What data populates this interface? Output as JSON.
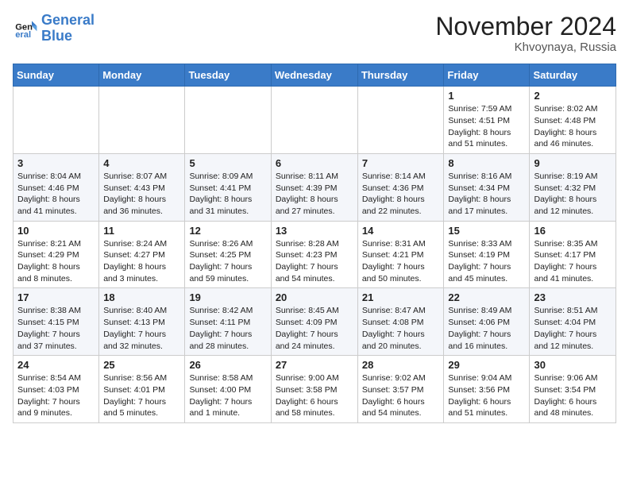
{
  "header": {
    "logo_line1": "General",
    "logo_line2": "Blue",
    "month_year": "November 2024",
    "location": "Khvoynaya, Russia"
  },
  "days_of_week": [
    "Sunday",
    "Monday",
    "Tuesday",
    "Wednesday",
    "Thursday",
    "Friday",
    "Saturday"
  ],
  "weeks": [
    [
      {
        "day": "",
        "info": ""
      },
      {
        "day": "",
        "info": ""
      },
      {
        "day": "",
        "info": ""
      },
      {
        "day": "",
        "info": ""
      },
      {
        "day": "",
        "info": ""
      },
      {
        "day": "1",
        "info": "Sunrise: 7:59 AM\nSunset: 4:51 PM\nDaylight: 8 hours and 51 minutes."
      },
      {
        "day": "2",
        "info": "Sunrise: 8:02 AM\nSunset: 4:48 PM\nDaylight: 8 hours and 46 minutes."
      }
    ],
    [
      {
        "day": "3",
        "info": "Sunrise: 8:04 AM\nSunset: 4:46 PM\nDaylight: 8 hours and 41 minutes."
      },
      {
        "day": "4",
        "info": "Sunrise: 8:07 AM\nSunset: 4:43 PM\nDaylight: 8 hours and 36 minutes."
      },
      {
        "day": "5",
        "info": "Sunrise: 8:09 AM\nSunset: 4:41 PM\nDaylight: 8 hours and 31 minutes."
      },
      {
        "day": "6",
        "info": "Sunrise: 8:11 AM\nSunset: 4:39 PM\nDaylight: 8 hours and 27 minutes."
      },
      {
        "day": "7",
        "info": "Sunrise: 8:14 AM\nSunset: 4:36 PM\nDaylight: 8 hours and 22 minutes."
      },
      {
        "day": "8",
        "info": "Sunrise: 8:16 AM\nSunset: 4:34 PM\nDaylight: 8 hours and 17 minutes."
      },
      {
        "day": "9",
        "info": "Sunrise: 8:19 AM\nSunset: 4:32 PM\nDaylight: 8 hours and 12 minutes."
      }
    ],
    [
      {
        "day": "10",
        "info": "Sunrise: 8:21 AM\nSunset: 4:29 PM\nDaylight: 8 hours and 8 minutes."
      },
      {
        "day": "11",
        "info": "Sunrise: 8:24 AM\nSunset: 4:27 PM\nDaylight: 8 hours and 3 minutes."
      },
      {
        "day": "12",
        "info": "Sunrise: 8:26 AM\nSunset: 4:25 PM\nDaylight: 7 hours and 59 minutes."
      },
      {
        "day": "13",
        "info": "Sunrise: 8:28 AM\nSunset: 4:23 PM\nDaylight: 7 hours and 54 minutes."
      },
      {
        "day": "14",
        "info": "Sunrise: 8:31 AM\nSunset: 4:21 PM\nDaylight: 7 hours and 50 minutes."
      },
      {
        "day": "15",
        "info": "Sunrise: 8:33 AM\nSunset: 4:19 PM\nDaylight: 7 hours and 45 minutes."
      },
      {
        "day": "16",
        "info": "Sunrise: 8:35 AM\nSunset: 4:17 PM\nDaylight: 7 hours and 41 minutes."
      }
    ],
    [
      {
        "day": "17",
        "info": "Sunrise: 8:38 AM\nSunset: 4:15 PM\nDaylight: 7 hours and 37 minutes."
      },
      {
        "day": "18",
        "info": "Sunrise: 8:40 AM\nSunset: 4:13 PM\nDaylight: 7 hours and 32 minutes."
      },
      {
        "day": "19",
        "info": "Sunrise: 8:42 AM\nSunset: 4:11 PM\nDaylight: 7 hours and 28 minutes."
      },
      {
        "day": "20",
        "info": "Sunrise: 8:45 AM\nSunset: 4:09 PM\nDaylight: 7 hours and 24 minutes."
      },
      {
        "day": "21",
        "info": "Sunrise: 8:47 AM\nSunset: 4:08 PM\nDaylight: 7 hours and 20 minutes."
      },
      {
        "day": "22",
        "info": "Sunrise: 8:49 AM\nSunset: 4:06 PM\nDaylight: 7 hours and 16 minutes."
      },
      {
        "day": "23",
        "info": "Sunrise: 8:51 AM\nSunset: 4:04 PM\nDaylight: 7 hours and 12 minutes."
      }
    ],
    [
      {
        "day": "24",
        "info": "Sunrise: 8:54 AM\nSunset: 4:03 PM\nDaylight: 7 hours and 9 minutes."
      },
      {
        "day": "25",
        "info": "Sunrise: 8:56 AM\nSunset: 4:01 PM\nDaylight: 7 hours and 5 minutes."
      },
      {
        "day": "26",
        "info": "Sunrise: 8:58 AM\nSunset: 4:00 PM\nDaylight: 7 hours and 1 minute."
      },
      {
        "day": "27",
        "info": "Sunrise: 9:00 AM\nSunset: 3:58 PM\nDaylight: 6 hours and 58 minutes."
      },
      {
        "day": "28",
        "info": "Sunrise: 9:02 AM\nSunset: 3:57 PM\nDaylight: 6 hours and 54 minutes."
      },
      {
        "day": "29",
        "info": "Sunrise: 9:04 AM\nSunset: 3:56 PM\nDaylight: 6 hours and 51 minutes."
      },
      {
        "day": "30",
        "info": "Sunrise: 9:06 AM\nSunset: 3:54 PM\nDaylight: 6 hours and 48 minutes."
      }
    ]
  ]
}
